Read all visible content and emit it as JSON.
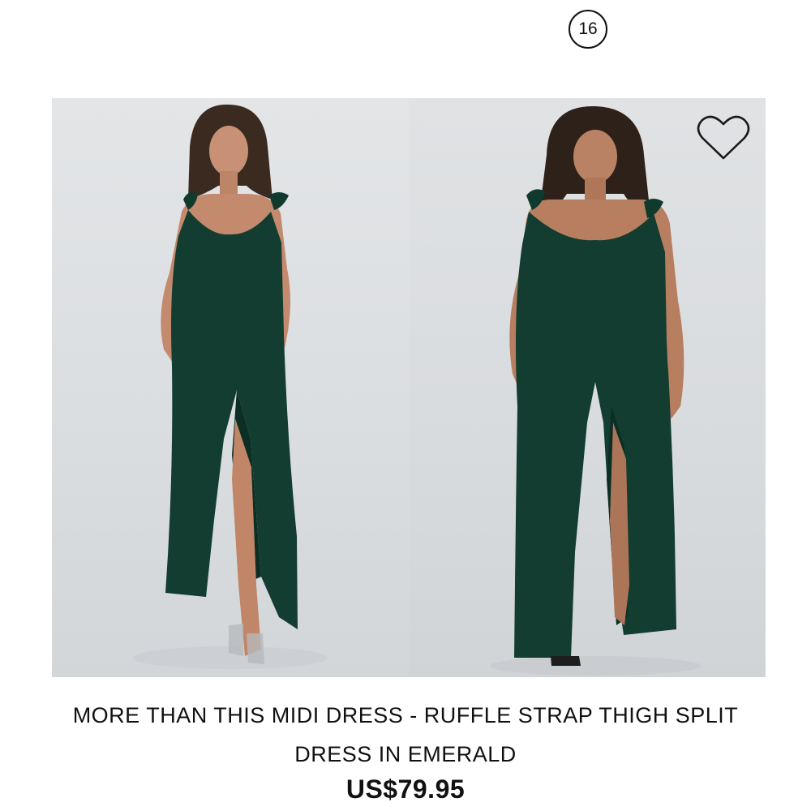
{
  "image_count_badge": "16",
  "product": {
    "title_line1": "MORE THAN THIS MIDI DRESS - RUFFLE STRAP THIGH SPLIT",
    "title_line2": "DRESS IN EMERALD",
    "price": "US$79.95"
  },
  "icons": {
    "wishlist": "heart-outline-icon"
  },
  "colors": {
    "dress": "#123d30",
    "background": "#dee1e3",
    "text": "#111111"
  }
}
